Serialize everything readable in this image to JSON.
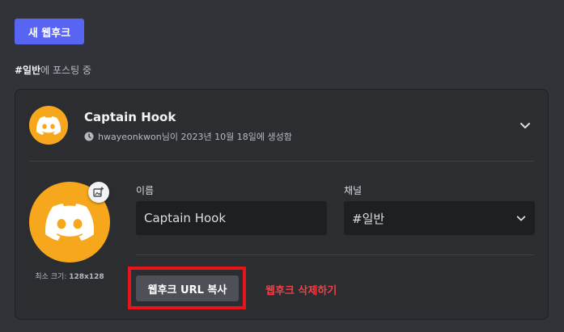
{
  "toolbar": {
    "new_webhook_label": "새 웹후크"
  },
  "posting": {
    "channel": "#일반",
    "suffix": "에 포스팅 중"
  },
  "webhook": {
    "name": "Captain Hook",
    "created_by": "hwayeonkwon님이 2023년 10월 18일에 생성함"
  },
  "form": {
    "name_label": "이름",
    "name_value": "Captain Hook",
    "channel_label": "채널",
    "channel_value": "#일반",
    "min_size_prefix": "최소 크기: ",
    "min_size_value": "128x128"
  },
  "actions": {
    "copy_url_label": "웹후크 URL 복사",
    "delete_label": "웹후크 삭제하기"
  },
  "colors": {
    "avatar_bg": "#f7a71c",
    "primary_button": "#5865f2",
    "danger": "#f23f43",
    "highlight": "#e8141c"
  },
  "icons": [
    "discord-logo-icon",
    "clock-icon",
    "chevron-down-icon",
    "add-image-icon"
  ]
}
